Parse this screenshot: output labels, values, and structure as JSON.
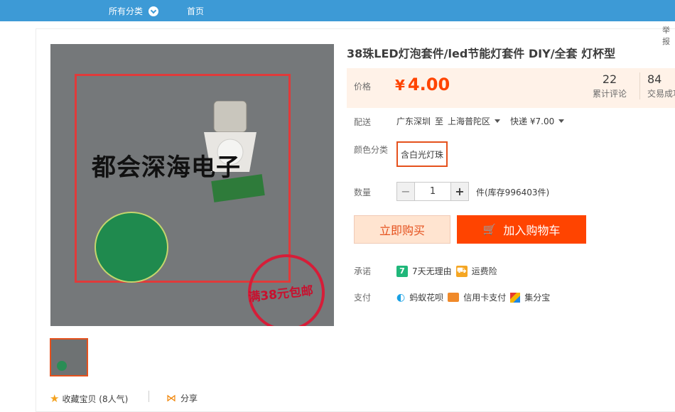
{
  "topnav": {
    "category_label": "所有分类",
    "home_label": "首页",
    "right_edge_text": "举报"
  },
  "product": {
    "title": "38珠LED灯泡套件/led节能灯套件 DIY/全套 灯杯型",
    "image_watermark": "都会深海电子",
    "image_stamp": "满38元包邮"
  },
  "price": {
    "label": "价格",
    "currency": "¥",
    "value": "4.00"
  },
  "stats": {
    "reviews_count": "22",
    "reviews_label": "累计评论",
    "trades_count": "84",
    "trades_label": "交易成功"
  },
  "shipping": {
    "label": "配送",
    "origin": "广东深圳",
    "to": "至",
    "destination": "上海普陀区",
    "method": "快递 ¥7.00"
  },
  "color": {
    "label": "颜色分类",
    "option": "含白光灯珠"
  },
  "quantity": {
    "label": "数量",
    "value": "1",
    "minus": "−",
    "plus": "+",
    "stock_text": "件(库存996403件)"
  },
  "actions": {
    "buy_now": "立即购买",
    "add_to_cart": "加入购物车"
  },
  "promise": {
    "label": "承诺",
    "seven_day_badge": "7",
    "seven_day": "7天无理由",
    "freight_ins": "运费险"
  },
  "payment": {
    "label": "支付",
    "huabei": "蚂蚁花呗",
    "credit_card": "信用卡支付",
    "jifenbao": "集分宝"
  },
  "footer": {
    "favorite": "收藏宝贝 (8人气)",
    "share": "分享"
  },
  "colors": {
    "accent": "#ff4400",
    "topbar": "#3d9ad6",
    "price_bg": "#fff2e8",
    "buy_bg": "#ffe4d0"
  }
}
